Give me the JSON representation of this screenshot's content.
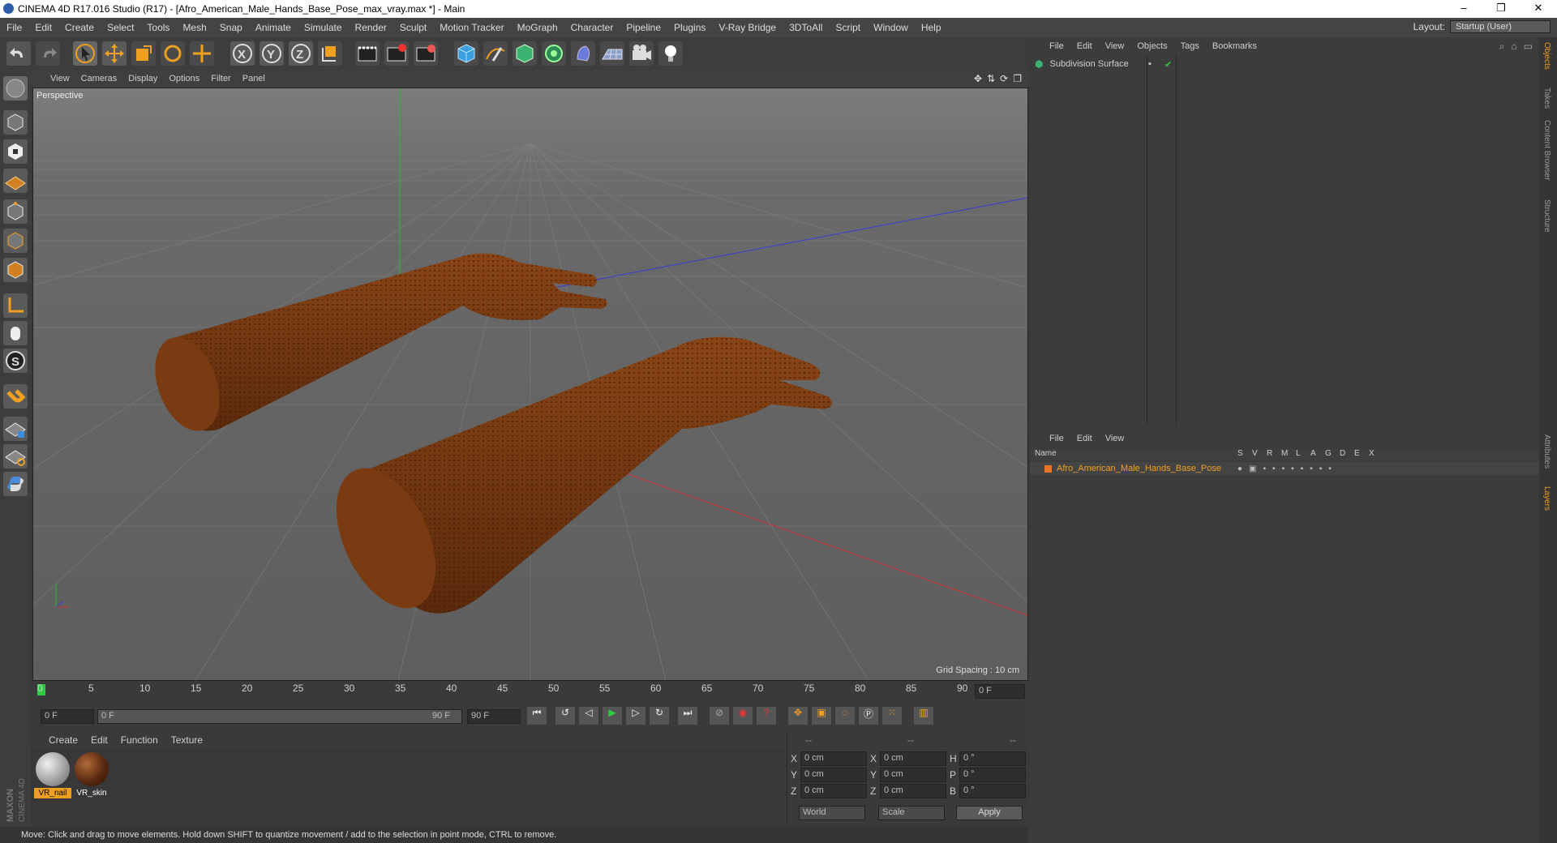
{
  "window": {
    "title": "CINEMA 4D R17.016 Studio (R17) - [Afro_American_Male_Hands_Base_Pose_max_vray.max *] - Main",
    "controls": [
      "–",
      "❐",
      "✕"
    ]
  },
  "menubar": {
    "items": [
      "File",
      "Edit",
      "Create",
      "Select",
      "Tools",
      "Mesh",
      "Snap",
      "Animate",
      "Simulate",
      "Render",
      "Sculpt",
      "Motion Tracker",
      "MoGraph",
      "Character",
      "Pipeline",
      "Plugins",
      "V-Ray Bridge",
      "3DToAll",
      "Script",
      "Window",
      "Help"
    ],
    "layout_label": "Layout:",
    "layout_value": "Startup (User)"
  },
  "viewport": {
    "menu": [
      "View",
      "Cameras",
      "Display",
      "Options",
      "Filter",
      "Panel"
    ],
    "camera_label": "Perspective",
    "grid_spacing": "Grid Spacing : 10 cm"
  },
  "timeline": {
    "ticks": [
      "0",
      "5",
      "10",
      "15",
      "20",
      "25",
      "30",
      "35",
      "40",
      "45",
      "50",
      "55",
      "60",
      "65",
      "70",
      "75",
      "80",
      "85",
      "90"
    ],
    "current_frame": "0 F",
    "start_frame": "0 F",
    "range_start": "0 F",
    "range_end": "90 F",
    "end_frame": "90 F"
  },
  "materials": {
    "menu": [
      "Create",
      "Edit",
      "Function",
      "Texture"
    ],
    "items": [
      {
        "name": "VR_nail",
        "color": "#c9c9c9"
      },
      {
        "name": "VR_skin",
        "color": "#5a2a10"
      }
    ]
  },
  "coords": {
    "header": [
      "--",
      "--",
      "--"
    ],
    "rows": [
      {
        "a": "X",
        "av": "0 cm",
        "b": "X",
        "bv": "0 cm",
        "c": "H",
        "cv": "0 °"
      },
      {
        "a": "Y",
        "av": "0 cm",
        "b": "Y",
        "bv": "0 cm",
        "c": "P",
        "cv": "0 °"
      },
      {
        "a": "Z",
        "av": "0 cm",
        "b": "Z",
        "bv": "0 cm",
        "c": "B",
        "cv": "0 °"
      }
    ],
    "space": "World",
    "mode": "Scale",
    "apply": "Apply"
  },
  "status": "Move: Click and drag to move elements. Hold down SHIFT to quantize movement / add to the selection in point mode, CTRL to remove.",
  "object_manager": {
    "menu": [
      "File",
      "Edit",
      "View",
      "Objects",
      "Tags",
      "Bookmarks"
    ],
    "objects": [
      {
        "name": "Subdivision Surface"
      }
    ]
  },
  "layer_manager": {
    "menu": [
      "File",
      "Edit",
      "View"
    ],
    "columns": [
      "Name",
      "S",
      "V",
      "R",
      "M",
      "L",
      "A",
      "G",
      "D",
      "E",
      "X"
    ],
    "layers": [
      {
        "name": "Afro_American_Male_Hands_Base_Pose",
        "color": "#e8752a"
      }
    ]
  },
  "right_tabs": [
    "Objects",
    "Takes",
    "Content Browser",
    "Structure",
    "Attributes",
    "Layers"
  ],
  "branding": "MAXON CINEMA 4D",
  "colors": {
    "accent": "#f0a020",
    "axis_x": "#d33",
    "axis_y": "#3c3",
    "axis_z": "#44d",
    "skin": "#6e3410"
  }
}
